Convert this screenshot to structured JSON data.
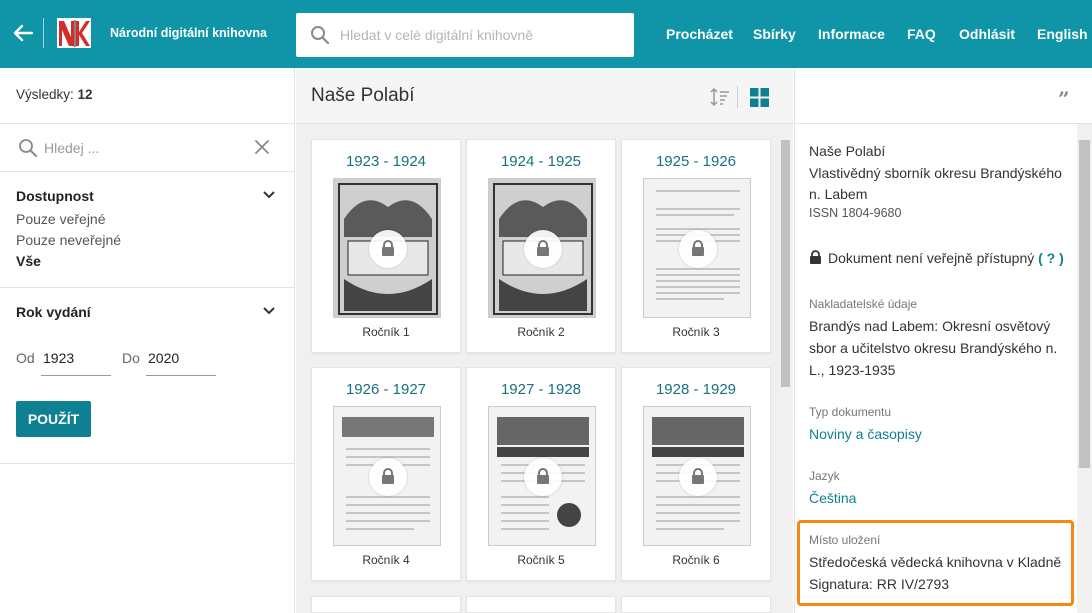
{
  "header": {
    "site_title": "Národní digitální knihovna",
    "search_placeholder": "Hledat v celé digitální knihovně",
    "nav": [
      "Procházet",
      "Sbírky",
      "Informace",
      "FAQ",
      "Odhlásit",
      "English"
    ],
    "brand_color": "#0f94a8",
    "icons": [
      "arrow-left-icon",
      "nk-logo",
      "search-icon"
    ]
  },
  "left": {
    "results_label": "Výsledky:",
    "results_count": "12",
    "filter_placeholder": "Hledej ...",
    "availability": {
      "title": "Dostupnost",
      "options": [
        "Pouze veřejné",
        "Pouze neveřejné",
        "Vše"
      ],
      "selected": "Vše"
    },
    "year": {
      "title": "Rok vydání",
      "from_label": "Od",
      "from_value": "1923",
      "to_label": "Do",
      "to_value": "2020",
      "apply_label": "POUŽÍT"
    }
  },
  "middle": {
    "title": "Naše Polabí",
    "cards": [
      {
        "years": "1923 - 1924",
        "volume": "Ročník 1"
      },
      {
        "years": "1924 - 1925",
        "volume": "Ročník 2"
      },
      {
        "years": "1925 - 1926",
        "volume": "Ročník 3"
      },
      {
        "years": "1926 - 1927",
        "volume": "Ročník 4"
      },
      {
        "years": "1927 - 1928",
        "volume": "Ročník 5"
      },
      {
        "years": "1928 - 1929",
        "volume": "Ročník 6"
      }
    ]
  },
  "right": {
    "title": "Naše Polabí",
    "subtitle": "Vlastivědný sborník okresu Brandýského n. Labem",
    "issn": "ISSN 1804-9680",
    "access_text": "Dokument není veřejně přístupný",
    "access_help": "( ? )",
    "publisher_label": "Nakladatelské údaje",
    "publisher_value": "Brandýs nad Labem: Okresní osvětový sbor a učitelstvo okresu Brandýského n. L., 1923-1935",
    "doctype_label": "Typ dokumentu",
    "doctype_value": "Noviny a časopisy",
    "language_label": "Jazyk",
    "language_value": "Čeština",
    "location_label": "Místo uložení",
    "location_value": "Středočeská vědecká knihovna v Kladně",
    "signature": "Signatura: RR IV/2793",
    "highlight_color": "#f6870f"
  }
}
